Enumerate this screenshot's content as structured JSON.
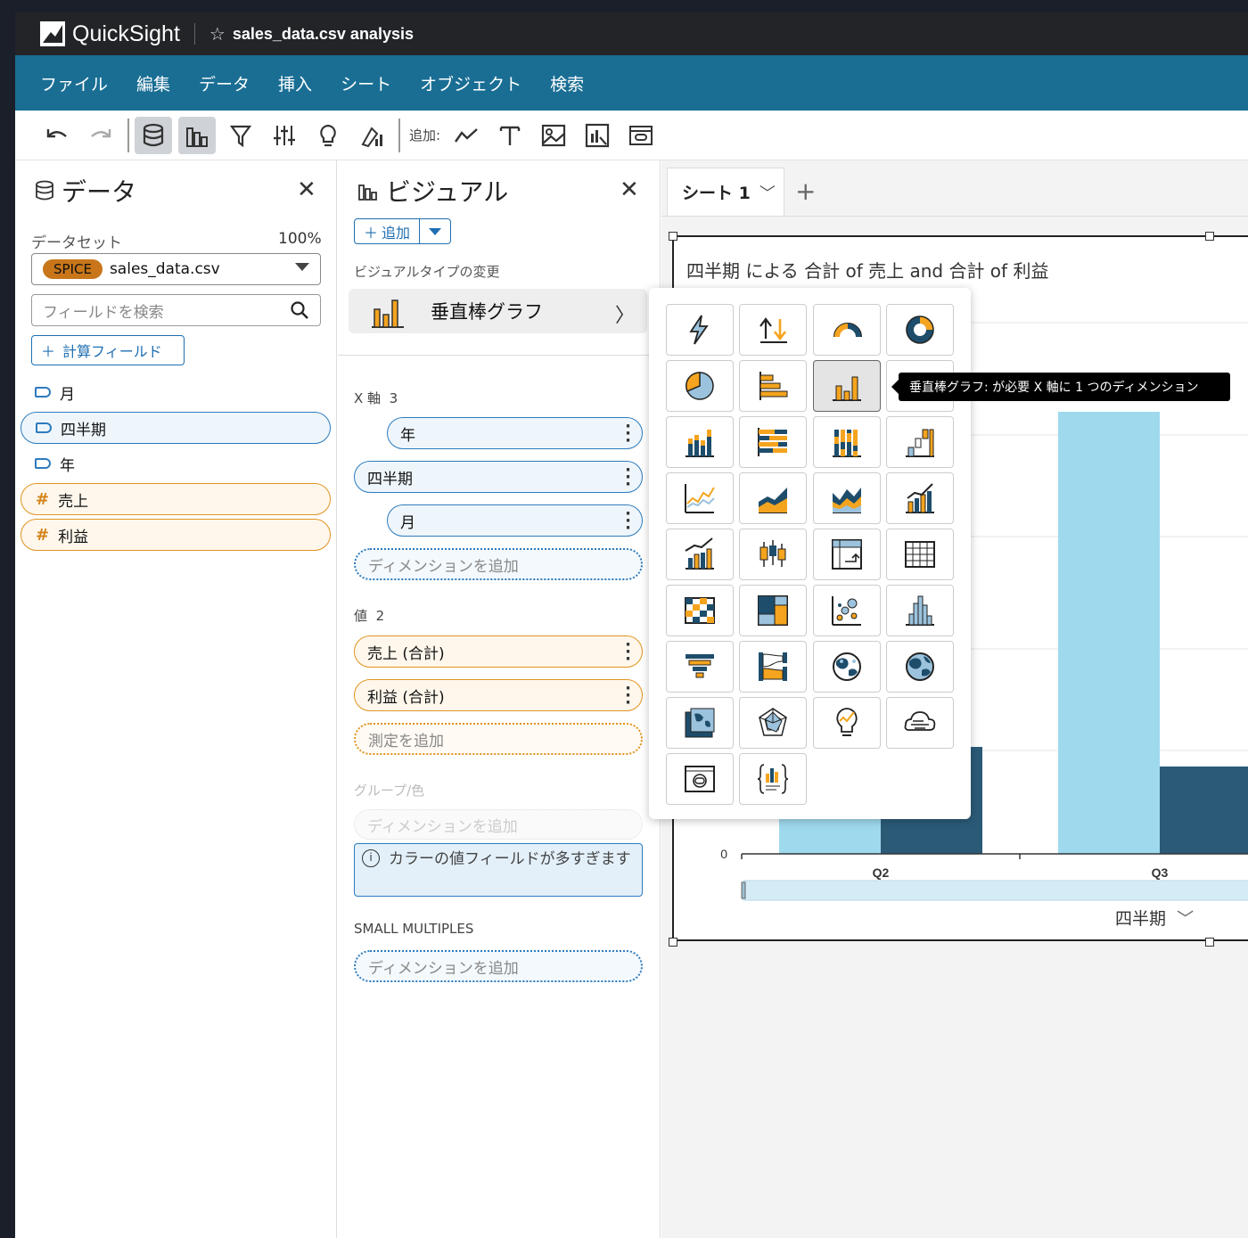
{
  "app": {
    "logo_text": "QuickSight",
    "analysis_name": "sales_data.csv analysis"
  },
  "menu": [
    "ファイル",
    "編集",
    "データ",
    "挿入",
    "シート",
    "オブジェクト",
    "検索"
  ],
  "toolbar": {
    "add_label": "追加:"
  },
  "data_panel": {
    "title": "データ",
    "dataset_label": "データセット",
    "dataset_percent": "100%",
    "spice_badge": "SPICE",
    "dataset_name": "sales_data.csv",
    "search_placeholder": "フィールドを検索",
    "calc_field_label": "計算フィールド",
    "fields": [
      {
        "name": "月",
        "kind": "dimension"
      },
      {
        "name": "四半期",
        "kind": "dimension"
      },
      {
        "name": "年",
        "kind": "dimension"
      },
      {
        "name": "売上",
        "kind": "measure"
      },
      {
        "name": "利益",
        "kind": "measure"
      }
    ]
  },
  "visual_panel": {
    "title": "ビジュアル",
    "add_label": "追加",
    "type_change_label": "ビジュアルタイプの変更",
    "selected_type": "垂直棒グラフ",
    "x_axis_label": "X 軸",
    "x_axis_count": "3",
    "x_fields": [
      "年",
      "四半期",
      "月"
    ],
    "add_dimension": "ディメンションを追加",
    "value_label": "値",
    "value_count": "2",
    "value_fields": [
      "売上 (合計)",
      "利益 (合計)"
    ],
    "add_measure": "測定を追加",
    "group_label": "グループ/色",
    "warning": "カラーの値フィールドが多すぎます",
    "small_multiples_label": "SMALL MULTIPLES"
  },
  "canvas": {
    "sheet_tab": "シート 1",
    "visual_title": "四半期 による 合計 of 売上 and 合計 of 利益",
    "x_axis_title": "四半期",
    "y_zero_label": "0",
    "tooltip": "垂直棒グラフ: が必要 X 軸に 1 つのディメンション"
  },
  "chart_data": {
    "type": "bar",
    "categories": [
      "Q2",
      "Q3"
    ],
    "series": [
      {
        "name": "合計 of 売上",
        "values": [
          null,
          null
        ],
        "color": "#9fd9ee"
      },
      {
        "name": "合計 of 利益",
        "values": [
          null,
          null
        ],
        "color": "#2b5a77"
      }
    ],
    "xlabel": "四半期"
  },
  "colors": {
    "accent": "#1a6e94",
    "dimension": "#2d7bbd",
    "measure": "#e0941f",
    "bar_light": "#9fd9ee",
    "bar_dark": "#2b5a77"
  },
  "chart_types": [
    "kpi-icon",
    "sort-arrows-icon",
    "gauge-icon",
    "donut-icon",
    "pie-icon",
    "horizontal-bar-icon",
    "vertical-bar-icon",
    "combo-icon",
    "stacked-bar-icon",
    "stacked-horizontal-bar-icon",
    "stacked-100-bar-icon",
    "waterfall-icon",
    "line-icon",
    "area-icon",
    "stacked-area-icon",
    "line-bar-combo-icon",
    "bar-trend-icon",
    "box-plot-icon",
    "pivot-table-icon",
    "table-icon",
    "heatmap-icon",
    "treemap-icon",
    "scatter-icon",
    "histogram-icon",
    "funnel-icon",
    "sankey-icon",
    "filled-map-icon",
    "points-map-icon",
    "map-region-icon",
    "radar-icon",
    "insight-icon",
    "word-cloud-icon",
    "custom-visual-icon",
    "custom-code-icon"
  ]
}
